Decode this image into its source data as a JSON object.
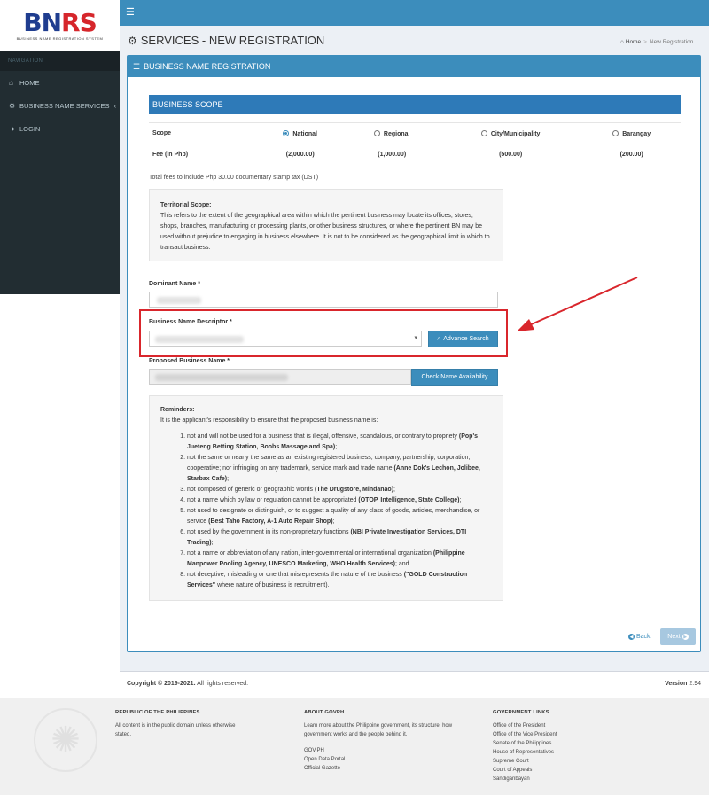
{
  "brand": {
    "logo_text_a": "BN",
    "logo_text_b": "RS",
    "logo_sub": "BUSINESS NAME REGISTRATION SYSTEM"
  },
  "sidebar": {
    "header": "NAVIGATION",
    "items": [
      {
        "label": "HOME",
        "icon": "home-icon"
      },
      {
        "label": "BUSINESS NAME SERVICES",
        "icon": "gears-icon"
      },
      {
        "label": "LOGIN",
        "icon": "sign-in-icon"
      }
    ]
  },
  "topbar": {
    "menu_icon": "☰"
  },
  "page": {
    "title": "SERVICES - NEW REGISTRATION",
    "breadcrumb": {
      "home": "Home",
      "current": "New Registration"
    }
  },
  "panel": {
    "title": "BUSINESS NAME REGISTRATION"
  },
  "scope": {
    "heading": "BUSINESS SCOPE",
    "row1_label": "Scope",
    "row2_label": "Fee (in Php)",
    "options": [
      {
        "label": "National",
        "fee": "(2,000.00)",
        "selected": true
      },
      {
        "label": "Regional",
        "fee": "(1,000.00)",
        "selected": false
      },
      {
        "label": "City/Municipality",
        "fee": "(500.00)",
        "selected": false
      },
      {
        "label": "Barangay",
        "fee": "(200.00)",
        "selected": false
      }
    ],
    "fees_note": "Total fees to include Php 30.00 documentary stamp tax (DST)"
  },
  "territorial": {
    "title": "Territorial Scope:",
    "body": "This refers to the extent of the geographical area within which the pertinent business may locate its offices, stores, shops, branches, manufacturing or processing plants, or other business structures, or where the pertinent BN may be used without prejudice to engaging in business elsewhere. It is not to be considered as the geographical limit in which to transact business."
  },
  "form": {
    "dominant_label": "Dominant Name *",
    "descriptor_label": "Business Name Descriptor *",
    "advance_search": "Advance Search",
    "proposed_label": "Proposed Business Name *",
    "check_button": "Check Name Availability"
  },
  "reminders": {
    "title": "Reminders:",
    "intro": "It is the applicant's responsibility to ensure that the proposed business name is:",
    "items": [
      {
        "text": "not and will not be used for a business that is illegal, offensive, scandalous, or contrary to propriety ",
        "bold": "(Pop's Jueteng Betting Station, Boobs Massage and Spa)",
        "tail": ";"
      },
      {
        "text": "not the same or nearly the same as an existing registered business, company, partnership, corporation, cooperative; nor infringing on any trademark, service mark and trade name ",
        "bold": "(Anne Dok's Lechon, Jolibee, Starbax Cafe)",
        "tail": ";"
      },
      {
        "text": "not composed of generic or geographic words ",
        "bold": "(The Drugstore, Mindanao)",
        "tail": ";"
      },
      {
        "text": "not a name which by law or regulation cannot be appropriated ",
        "bold": "(OTOP, Intelligence, State College)",
        "tail": ";"
      },
      {
        "text": "not used to designate or distinguish, or to suggest a quality of any class of goods, articles, merchandise, or service ",
        "bold": "(Best Taho Factory, A-1 Auto Repair Shop)",
        "tail": ";"
      },
      {
        "text": "not used by the government in its non-proprietary functions ",
        "bold": "(NBI Private Investigation Services, DTI Trading)",
        "tail": ";"
      },
      {
        "text": "not a name or abbreviation of any nation, inter-governmental or international organization ",
        "bold": "(Philippine Manpower Pooling Agency, UNESCO Marketing, WHO Health Services)",
        "tail": "; and"
      },
      {
        "text": "not deceptive, misleading or one that misrepresents the nature of the business ",
        "bold": "(\"GOLD Construction Services\"",
        "tail": " where nature of business is recruitment)."
      }
    ]
  },
  "actions": {
    "back": "Back",
    "next": "Next"
  },
  "footer": {
    "copyright_bold": "Copyright © 2019-2021.",
    "copyright_rest": " All rights reserved.",
    "version_label": "Version",
    "version": "2.94",
    "col1_title": "REPUBLIC OF THE PHILIPPINES",
    "col1_text": "All content is in the public domain unless otherwise stated.",
    "col2_title": "ABOUT GOVPH",
    "col2_text": "Learn more about the Philippine government, its structure, how government works and the people behind it.",
    "col2_links": [
      "GOV.PH",
      "Open Data Portal",
      "Official Gazette"
    ],
    "col3_title": "GOVERNMENT LINKS",
    "col3_links": [
      "Office of the President",
      "Office of the Vice President",
      "Senate of the Philippines",
      "House of Representatives",
      "Supreme Court",
      "Court of Appeals",
      "Sandiganbayan"
    ]
  }
}
